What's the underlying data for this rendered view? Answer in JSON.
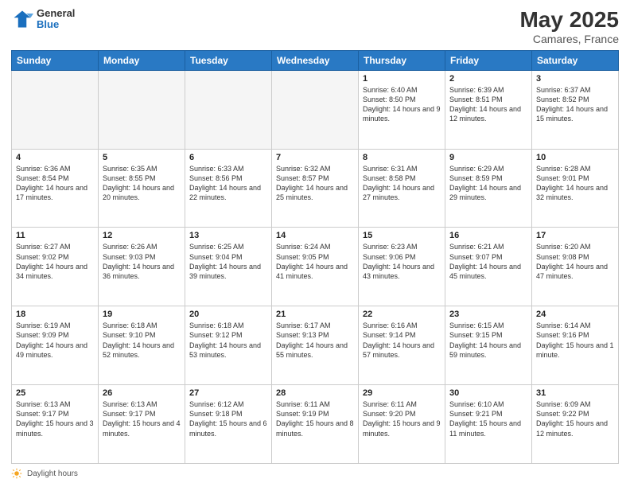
{
  "header": {
    "logo_general": "General",
    "logo_blue": "Blue",
    "title": "May 2025",
    "location": "Camares, France"
  },
  "days_of_week": [
    "Sunday",
    "Monday",
    "Tuesday",
    "Wednesday",
    "Thursday",
    "Friday",
    "Saturday"
  ],
  "footer": {
    "label": "Daylight hours"
  },
  "weeks": [
    {
      "cells": [
        {
          "day": "",
          "empty": true
        },
        {
          "day": "",
          "empty": true
        },
        {
          "day": "",
          "empty": true
        },
        {
          "day": "",
          "empty": true
        },
        {
          "day": "1",
          "sunrise": "6:40 AM",
          "sunset": "8:50 PM",
          "daylight": "14 hours and 9 minutes."
        },
        {
          "day": "2",
          "sunrise": "6:39 AM",
          "sunset": "8:51 PM",
          "daylight": "14 hours and 12 minutes."
        },
        {
          "day": "3",
          "sunrise": "6:37 AM",
          "sunset": "8:52 PM",
          "daylight": "14 hours and 15 minutes."
        }
      ]
    },
    {
      "cells": [
        {
          "day": "4",
          "sunrise": "6:36 AM",
          "sunset": "8:54 PM",
          "daylight": "14 hours and 17 minutes."
        },
        {
          "day": "5",
          "sunrise": "6:35 AM",
          "sunset": "8:55 PM",
          "daylight": "14 hours and 20 minutes."
        },
        {
          "day": "6",
          "sunrise": "6:33 AM",
          "sunset": "8:56 PM",
          "daylight": "14 hours and 22 minutes."
        },
        {
          "day": "7",
          "sunrise": "6:32 AM",
          "sunset": "8:57 PM",
          "daylight": "14 hours and 25 minutes."
        },
        {
          "day": "8",
          "sunrise": "6:31 AM",
          "sunset": "8:58 PM",
          "daylight": "14 hours and 27 minutes."
        },
        {
          "day": "9",
          "sunrise": "6:29 AM",
          "sunset": "8:59 PM",
          "daylight": "14 hours and 29 minutes."
        },
        {
          "day": "10",
          "sunrise": "6:28 AM",
          "sunset": "9:01 PM",
          "daylight": "14 hours and 32 minutes."
        }
      ]
    },
    {
      "cells": [
        {
          "day": "11",
          "sunrise": "6:27 AM",
          "sunset": "9:02 PM",
          "daylight": "14 hours and 34 minutes."
        },
        {
          "day": "12",
          "sunrise": "6:26 AM",
          "sunset": "9:03 PM",
          "daylight": "14 hours and 36 minutes."
        },
        {
          "day": "13",
          "sunrise": "6:25 AM",
          "sunset": "9:04 PM",
          "daylight": "14 hours and 39 minutes."
        },
        {
          "day": "14",
          "sunrise": "6:24 AM",
          "sunset": "9:05 PM",
          "daylight": "14 hours and 41 minutes."
        },
        {
          "day": "15",
          "sunrise": "6:23 AM",
          "sunset": "9:06 PM",
          "daylight": "14 hours and 43 minutes."
        },
        {
          "day": "16",
          "sunrise": "6:21 AM",
          "sunset": "9:07 PM",
          "daylight": "14 hours and 45 minutes."
        },
        {
          "day": "17",
          "sunrise": "6:20 AM",
          "sunset": "9:08 PM",
          "daylight": "14 hours and 47 minutes."
        }
      ]
    },
    {
      "cells": [
        {
          "day": "18",
          "sunrise": "6:19 AM",
          "sunset": "9:09 PM",
          "daylight": "14 hours and 49 minutes."
        },
        {
          "day": "19",
          "sunrise": "6:18 AM",
          "sunset": "9:10 PM",
          "daylight": "14 hours and 52 minutes."
        },
        {
          "day": "20",
          "sunrise": "6:18 AM",
          "sunset": "9:12 PM",
          "daylight": "14 hours and 53 minutes."
        },
        {
          "day": "21",
          "sunrise": "6:17 AM",
          "sunset": "9:13 PM",
          "daylight": "14 hours and 55 minutes."
        },
        {
          "day": "22",
          "sunrise": "6:16 AM",
          "sunset": "9:14 PM",
          "daylight": "14 hours and 57 minutes."
        },
        {
          "day": "23",
          "sunrise": "6:15 AM",
          "sunset": "9:15 PM",
          "daylight": "14 hours and 59 minutes."
        },
        {
          "day": "24",
          "sunrise": "6:14 AM",
          "sunset": "9:16 PM",
          "daylight": "15 hours and 1 minute."
        }
      ]
    },
    {
      "cells": [
        {
          "day": "25",
          "sunrise": "6:13 AM",
          "sunset": "9:17 PM",
          "daylight": "15 hours and 3 minutes."
        },
        {
          "day": "26",
          "sunrise": "6:13 AM",
          "sunset": "9:17 PM",
          "daylight": "15 hours and 4 minutes."
        },
        {
          "day": "27",
          "sunrise": "6:12 AM",
          "sunset": "9:18 PM",
          "daylight": "15 hours and 6 minutes."
        },
        {
          "day": "28",
          "sunrise": "6:11 AM",
          "sunset": "9:19 PM",
          "daylight": "15 hours and 8 minutes."
        },
        {
          "day": "29",
          "sunrise": "6:11 AM",
          "sunset": "9:20 PM",
          "daylight": "15 hours and 9 minutes."
        },
        {
          "day": "30",
          "sunrise": "6:10 AM",
          "sunset": "9:21 PM",
          "daylight": "15 hours and 11 minutes."
        },
        {
          "day": "31",
          "sunrise": "6:09 AM",
          "sunset": "9:22 PM",
          "daylight": "15 hours and 12 minutes."
        }
      ]
    }
  ]
}
